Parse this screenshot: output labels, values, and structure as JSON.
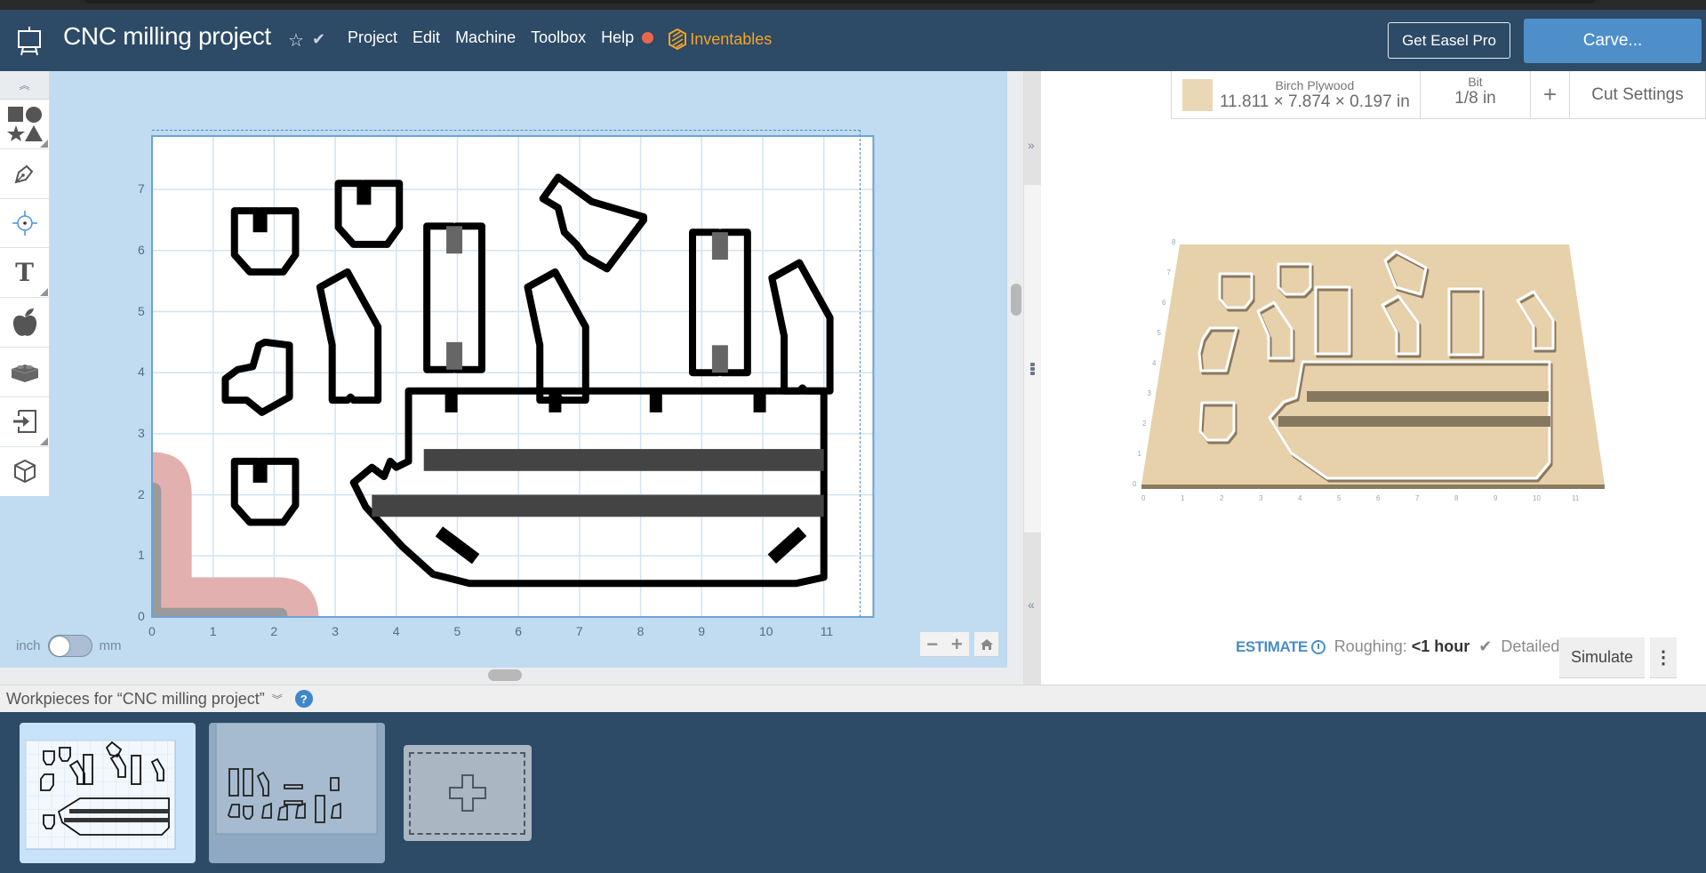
{
  "header": {
    "project_title": "CNC milling project",
    "nav": [
      "Project",
      "Edit",
      "Machine",
      "Toolbox",
      "Help"
    ],
    "brand_link": "Inventables",
    "get_pro_label": "Get Easel Pro",
    "carve_label": "Carve..."
  },
  "colors": {
    "header_bg": "#2d4a66",
    "accent_blue": "#4e8fc9",
    "brand_orange": "#f3a52a",
    "notification_dot": "#e8674b",
    "canvas_bg": "#c1dbf0",
    "material_color": "#ead7b6"
  },
  "toolbar": {
    "tools": [
      "shapes-icon",
      "pen-icon",
      "point-icon",
      "text-icon",
      "apple-icon",
      "brick-icon",
      "import-icon",
      "3d-cube-icon"
    ]
  },
  "canvas": {
    "x_ticks": [
      "0",
      "1",
      "2",
      "3",
      "4",
      "5",
      "6",
      "7",
      "8",
      "9",
      "10",
      "11"
    ],
    "y_ticks": [
      "0",
      "1",
      "2",
      "3",
      "4",
      "5",
      "6",
      "7"
    ],
    "units": {
      "left": "inch",
      "right": "mm",
      "selected": "inch"
    }
  },
  "material_bar": {
    "material_name": "Birch Plywood",
    "dimensions": "11.811 × 7.874 × 0.197 in",
    "bit_label": "Bit",
    "bit_value": "1/8 in",
    "add_label": "+",
    "cut_settings_label": "Cut Settings"
  },
  "preview": {
    "x_ticks": [
      "0",
      "1",
      "2",
      "3",
      "4",
      "5",
      "6",
      "7",
      "8",
      "9",
      "10",
      "11"
    ],
    "y_ticks": [
      "0",
      "1",
      "2",
      "3",
      "4",
      "5",
      "6",
      "7",
      "8"
    ]
  },
  "estimate": {
    "label": "ESTIMATE",
    "roughing_label": "Roughing:",
    "roughing_value": "<1 hour",
    "detailed_label": "Detailed",
    "simulate_label": "Simulate",
    "more_label": "⋮"
  },
  "workpieces": {
    "header": "Workpieces for “CNC milling project”",
    "help": "?",
    "cards": [
      "workpiece-1",
      "workpiece-2"
    ],
    "add_label": "+"
  }
}
